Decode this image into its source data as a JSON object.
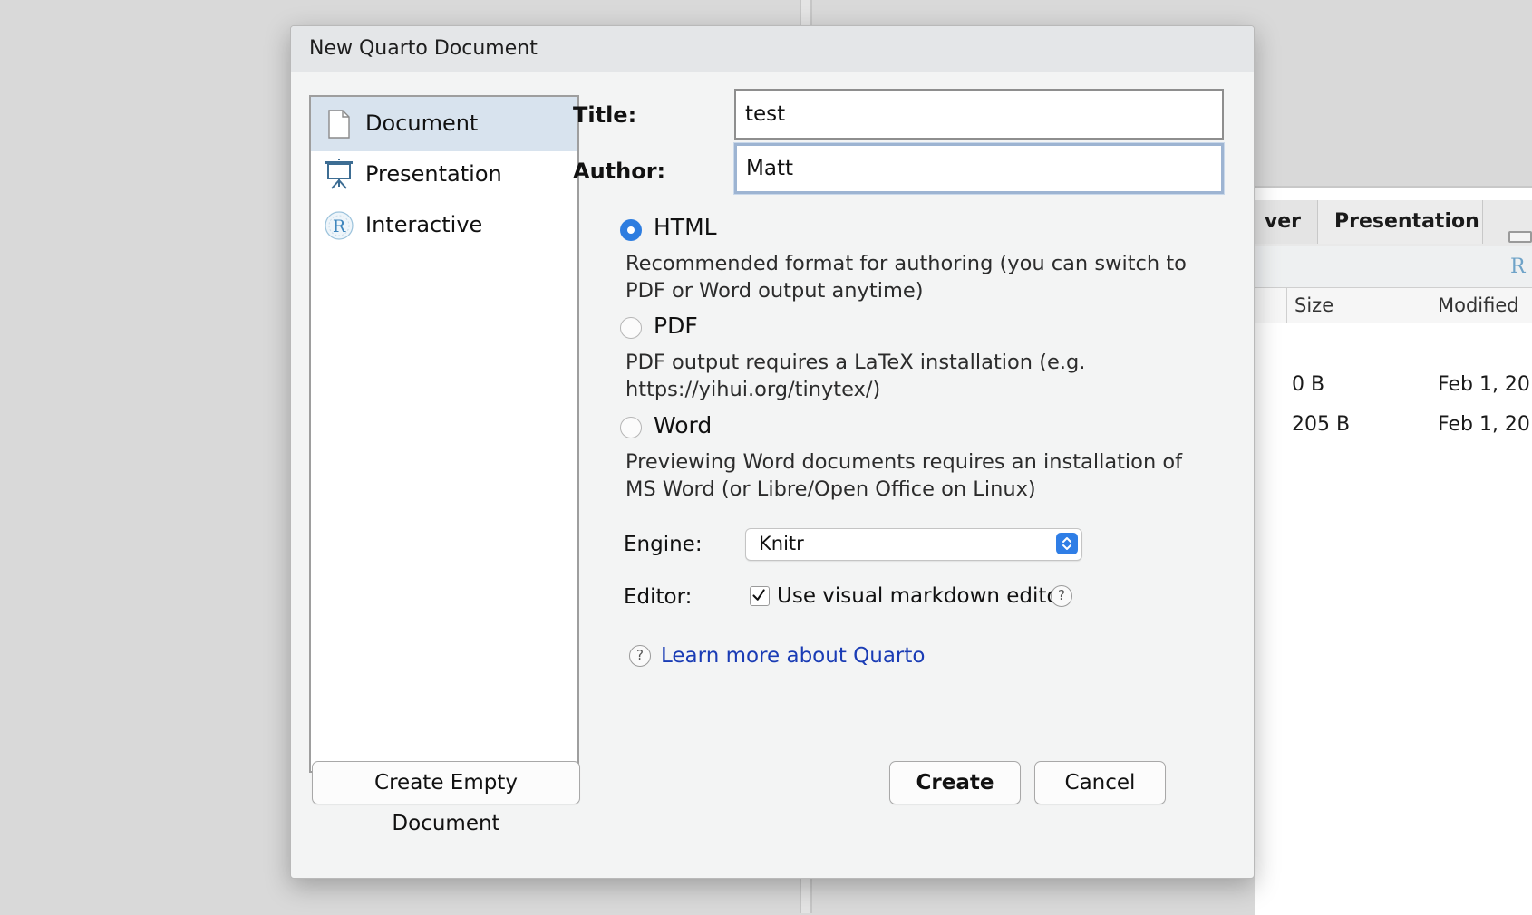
{
  "background": {
    "tabs": [
      "ver",
      "Presentation"
    ],
    "columns": [
      "Size",
      "Modified"
    ],
    "rows": [
      {
        "size": "0 B",
        "modified": "Feb 1, 20"
      },
      {
        "size": "205 B",
        "modified": "Feb 1, 20"
      }
    ]
  },
  "dialog": {
    "title": "New Quarto Document",
    "types": [
      {
        "label": "Document",
        "icon": "document-icon",
        "selected": true
      },
      {
        "label": "Presentation",
        "icon": "presentation-icon",
        "selected": false
      },
      {
        "label": "Interactive",
        "icon": "r-logo-icon",
        "selected": false
      }
    ],
    "fields": {
      "title_label": "Title:",
      "title_value": "test",
      "author_label": "Author:",
      "author_value": "Matt"
    },
    "formats": [
      {
        "label": "HTML",
        "selected": true,
        "description": "Recommended format for authoring (you can switch to PDF or Word output anytime)"
      },
      {
        "label": "PDF",
        "selected": false,
        "description": "PDF output requires a LaTeX installation (e.g. https://yihui.org/tinytex/)"
      },
      {
        "label": "Word",
        "selected": false,
        "description": "Previewing Word documents requires an installation of MS Word (or Libre/Open Office on Linux)"
      }
    ],
    "engine": {
      "label": "Engine:",
      "value": "Knitr"
    },
    "editor": {
      "label": "Editor:",
      "checkbox_label": "Use visual markdown editor",
      "checked": true
    },
    "learn_more": "Learn more about Quarto",
    "buttons": {
      "create_empty": "Create Empty Document",
      "create": "Create",
      "cancel": "Cancel"
    },
    "colors": {
      "accent": "#2d7de0",
      "selected_row": "#d8e3ee",
      "link": "#1a3cb5"
    }
  }
}
